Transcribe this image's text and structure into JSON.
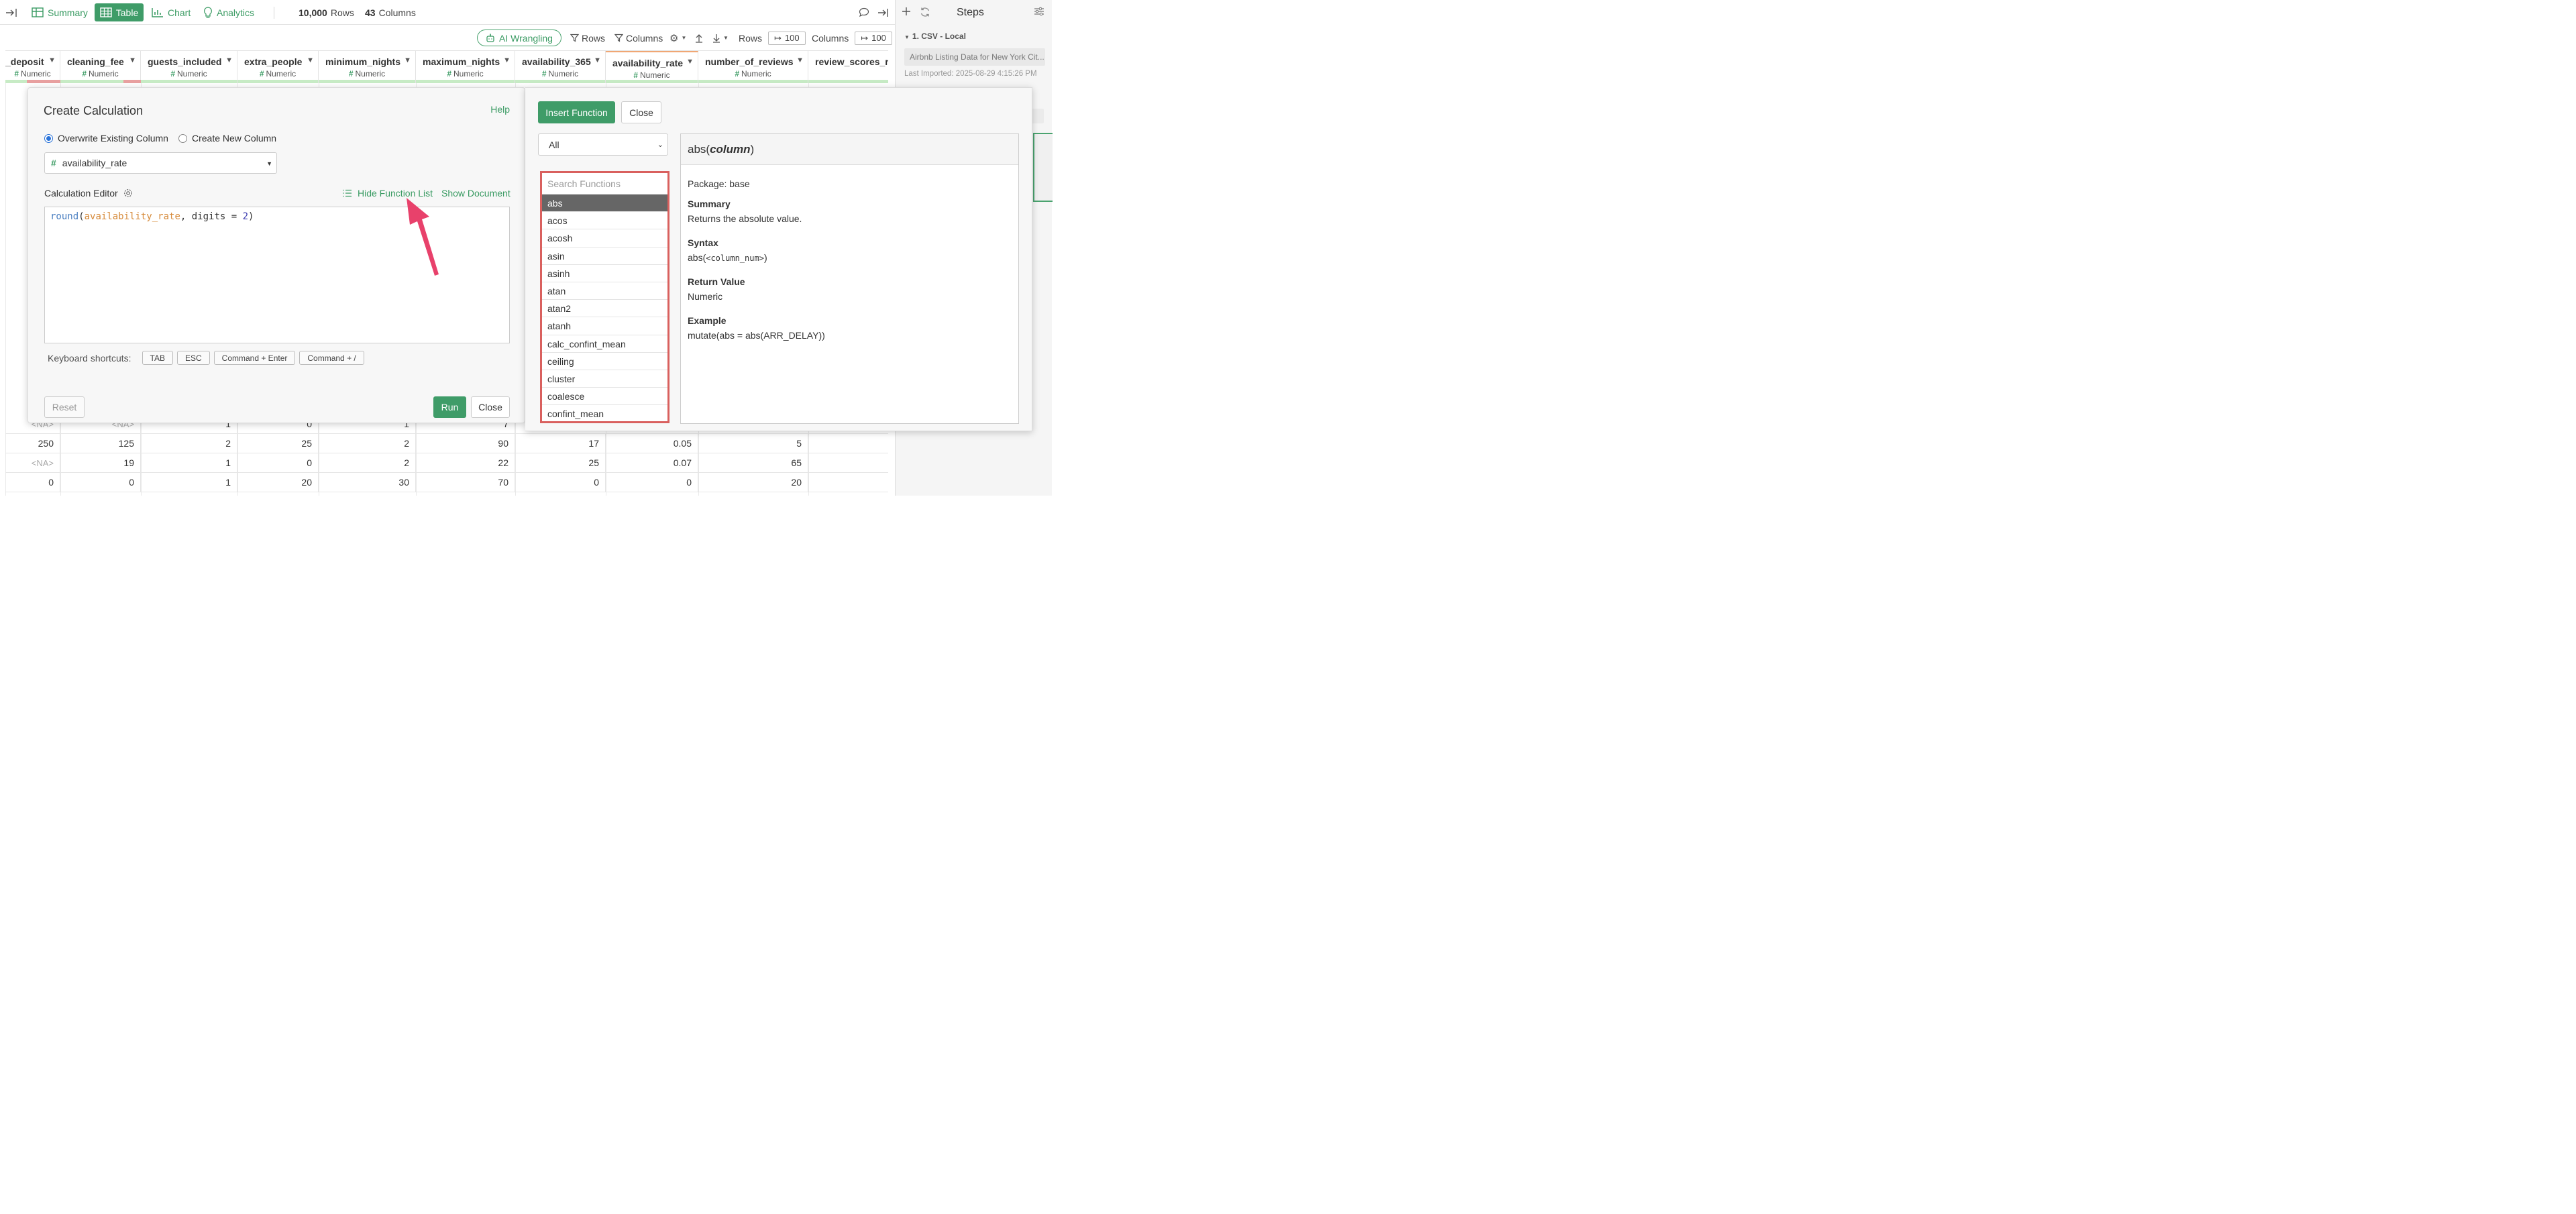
{
  "toolbar": {
    "summary": "Summary",
    "table": "Table",
    "chart": "Chart",
    "analytics": "Analytics",
    "rows_count": "10,000",
    "rows_label": "Rows",
    "cols_count": "43",
    "cols_label": "Columns"
  },
  "toolbar2": {
    "ai_wrangling": "AI Wrangling",
    "rows_filter": "Rows",
    "columns_filter": "Columns",
    "rows_label": "Rows",
    "rows_value": "100",
    "columns_label": "Columns",
    "columns_value": "100"
  },
  "columns": [
    {
      "name": "_deposit",
      "type": "Numeric"
    },
    {
      "name": "cleaning_fee",
      "type": "Numeric"
    },
    {
      "name": "guests_included",
      "type": "Numeric"
    },
    {
      "name": "extra_people",
      "type": "Numeric"
    },
    {
      "name": "minimum_nights",
      "type": "Numeric"
    },
    {
      "name": "maximum_nights",
      "type": "Numeric"
    },
    {
      "name": "availability_365",
      "type": "Numeric"
    },
    {
      "name": "availability_rate",
      "type": "Numeric"
    },
    {
      "name": "number_of_reviews",
      "type": "Numeric"
    },
    {
      "name": "review_scores_ra",
      "type": "Nu"
    }
  ],
  "rows": [
    [
      "<NA>",
      "<NA>",
      "1",
      "0",
      "1",
      "7",
      "",
      "",
      "",
      ""
    ],
    [
      "250",
      "125",
      "2",
      "25",
      "2",
      "90",
      "17",
      "0.05",
      "5",
      ""
    ],
    [
      "<NA>",
      "19",
      "1",
      "0",
      "2",
      "22",
      "25",
      "0.07",
      "65",
      ""
    ],
    [
      "0",
      "0",
      "1",
      "20",
      "30",
      "70",
      "0",
      "0",
      "20",
      ""
    ]
  ],
  "dialog": {
    "title": "Create Calculation",
    "help": "Help",
    "overwrite_label": "Overwrite Existing Column",
    "create_label": "Create New Column",
    "selected_column": "availability_rate",
    "editor_label": "Calculation Editor",
    "hide_function_list": "Hide Function List",
    "show_document": "Show Document",
    "code": {
      "fn": "round",
      "open": "(",
      "col": "availability_rate",
      "mid": ", digits = ",
      "num": "2",
      "close": ")"
    },
    "shortcuts_label": "Keyboard shortcuts:",
    "shortcuts": [
      "TAB",
      "ESC",
      "Command + Enter",
      "Command + /"
    ],
    "reset": "Reset",
    "run": "Run",
    "close": "Close"
  },
  "function_panel": {
    "insert": "Insert Function",
    "close": "Close",
    "category": "All",
    "search_placeholder": "Search Functions",
    "functions": [
      "abs",
      "acos",
      "acosh",
      "asin",
      "asinh",
      "atan",
      "atan2",
      "atanh",
      "calc_confint_mean",
      "ceiling",
      "cluster",
      "coalesce",
      "confint_mean"
    ],
    "doc": {
      "fn": "abs",
      "arg": "column",
      "package": "Package: base",
      "summary_label": "Summary",
      "summary": "Returns the absolute value.",
      "syntax_label": "Syntax",
      "syntax_prefix": "abs(",
      "syntax_arg": "<column_num>",
      "syntax_suffix": ")",
      "return_label": "Return Value",
      "return_value": "Numeric",
      "example_label": "Example",
      "example": "mutate(abs = abs(ARR_DELAY))"
    }
  },
  "sidebar": {
    "title": "Steps",
    "step": "1. CSV - Local",
    "data_name": "Airbnb Listing Data for New York Cit...",
    "imported": "Last Imported: 2025-08-29 4:15:26 PM"
  },
  "colors": {
    "accent": "#3f9c68",
    "highlight": "#d9605e",
    "arrow": "#e8416b"
  }
}
